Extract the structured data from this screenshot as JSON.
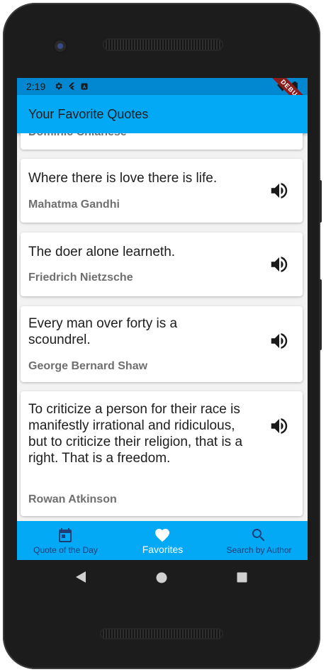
{
  "status_bar": {
    "time": "2:19",
    "debug_label": "DEBUG"
  },
  "app_bar": {
    "title": "Your Favorite Quotes"
  },
  "partial_card": {
    "author": "Dominic Chianese"
  },
  "quotes": [
    {
      "quote": "Where there is love there is life.",
      "author": "Mahatma Gandhi",
      "icon": "volume-up-icon"
    },
    {
      "quote": "The doer alone learneth.",
      "author": "Friedrich Nietzsche",
      "icon": "volume-up-icon"
    },
    {
      "quote": "Every man over forty is a scoundrel.",
      "author": "George Bernard Shaw",
      "icon": "volume-up-icon"
    },
    {
      "quote": "To criticize a person for their race is manifestly irrational and ridiculous, but to criticize their religion, that is a right. That is a freedom.",
      "author": "Rowan Atkinson",
      "icon": "volume-up-icon"
    }
  ],
  "bottom_nav": {
    "items": [
      {
        "label": "Quote of the Day",
        "icon": "calendar-icon",
        "active": false
      },
      {
        "label": "Favorites",
        "icon": "heart-icon",
        "active": true
      },
      {
        "label": "Search by Author",
        "icon": "search-icon",
        "active": false
      }
    ]
  },
  "colors": {
    "app_bar": "#03a9f4",
    "status_bar": "#0288d1",
    "inactive_nav": "#1e3e78",
    "active_nav": "#ffffff"
  }
}
